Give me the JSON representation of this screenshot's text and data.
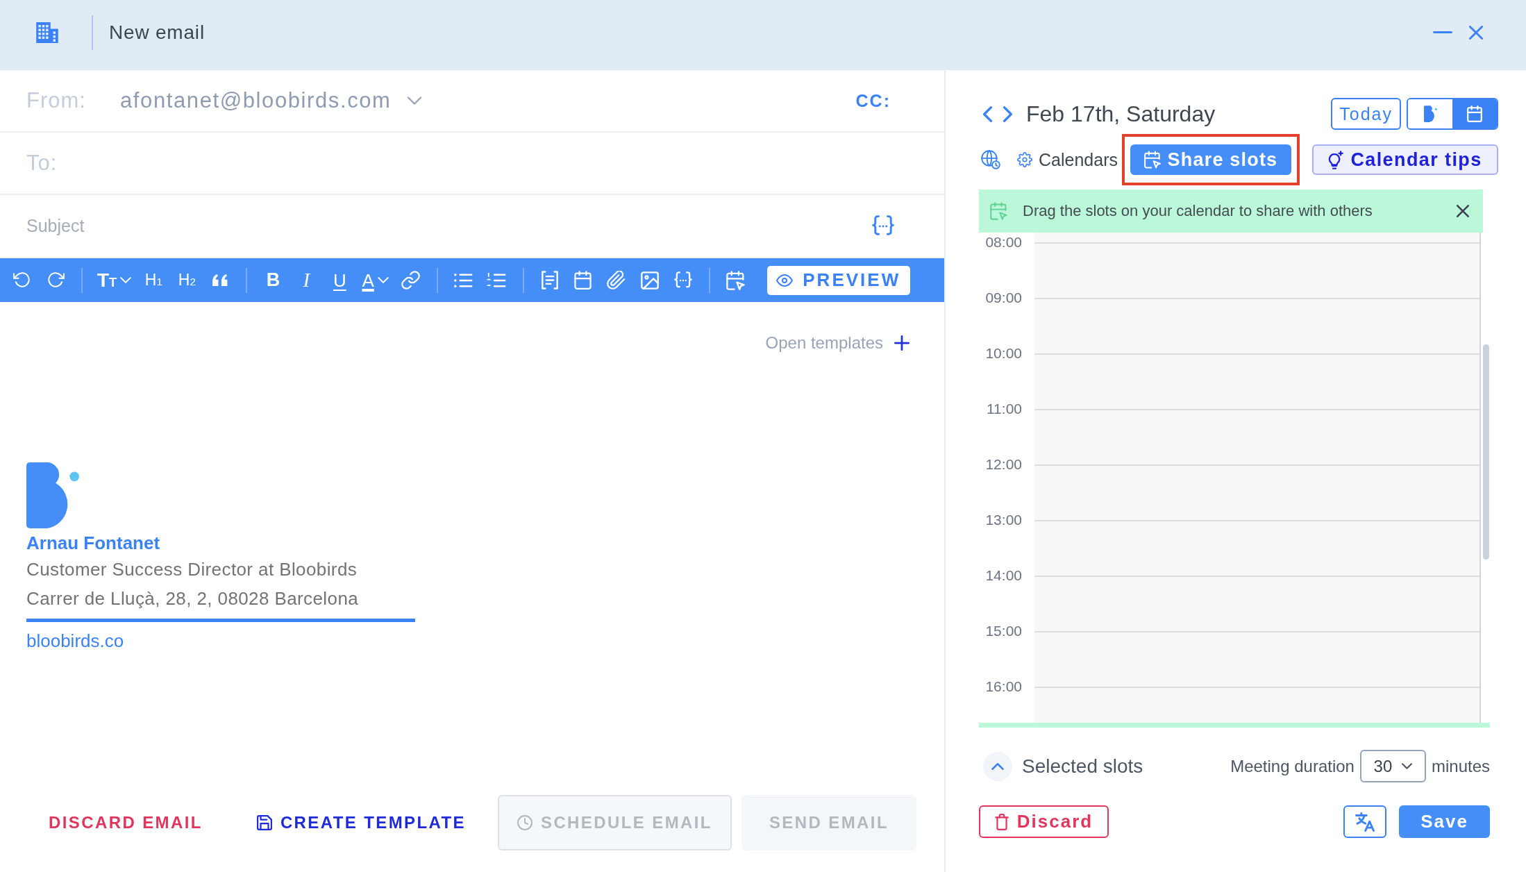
{
  "window": {
    "title": "New email"
  },
  "composer": {
    "from": {
      "label": "From:",
      "value": "afontanet@bloobirds.com"
    },
    "cc": "CC:",
    "to": {
      "label": "To:"
    },
    "subject": {
      "placeholder": "Subject"
    },
    "toolbar": {
      "groups": [
        [
          {
            "kind": "undo"
          },
          {
            "kind": "redo"
          }
        ],
        [
          {
            "kind": "text-size",
            "label": "T$_{T}$"
          },
          {
            "kind": "heading",
            "label": "H$_{1}$"
          },
          {
            "kind": "heading",
            "label": "H$_{2}$"
          },
          {
            "kind": "quote"
          }
        ],
        [
          {
            "kind": "bold",
            "label": "B"
          },
          {
            "kind": "italic",
            "label": "I"
          },
          {
            "kind": "underline",
            "label": "U"
          },
          {
            "kind": "color",
            "label": "A"
          },
          {
            "kind": "link"
          }
        ],
        [
          {
            "kind": "bullets"
          },
          {
            "kind": "numbers"
          }
        ],
        [
          {
            "kind": "snippet"
          },
          {
            "kind": "calendar"
          },
          {
            "kind": "attach"
          },
          {
            "kind": "image"
          },
          {
            "kind": "variable"
          }
        ],
        [
          {
            "kind": "meeting"
          }
        ]
      ],
      "preview": "PREVIEW"
    },
    "open_templates": "Open templates",
    "signature": {
      "name": "Arnau Fontanet",
      "lines": [
        "Customer Success Director at Bloobirds",
        "Carrer de Lluçà, 28, 2, 08028 Barcelona"
      ],
      "link": "bloobirds.co"
    },
    "actions": [
      {
        "kind": "danger",
        "label": "DISCARD EMAIL",
        "disabled": false
      },
      {
        "kind": "template",
        "label": "CREATE TEMPLATE",
        "disabled": false
      },
      {
        "kind": "schedule",
        "label": "SCHEDULE EMAIL",
        "disabled": true
      },
      {
        "kind": "send",
        "label": "SEND EMAIL",
        "disabled": true
      }
    ]
  },
  "calendar": {
    "date": "Feb 17th, Saturday",
    "today": "Today",
    "view_toggle": [
      {
        "kind": "logo",
        "selected": false
      },
      {
        "kind": "calendar",
        "selected": true
      }
    ],
    "calendars": "Calendars",
    "share_slots": {
      "label": "Share slots",
      "highlighted": true
    },
    "tips": "Calendar tips",
    "banner": "Drag the slots on your calendar to share with others",
    "hours": [
      "08:00",
      "09:00",
      "10:00",
      "11:00",
      "12:00",
      "13:00",
      "14:00",
      "15:00",
      "16:00"
    ],
    "selected_slots": "Selected slots",
    "meeting_duration": {
      "label": "Meeting duration",
      "value": "30",
      "unit": "minutes"
    },
    "discard": "Discard",
    "save": "Save"
  }
}
